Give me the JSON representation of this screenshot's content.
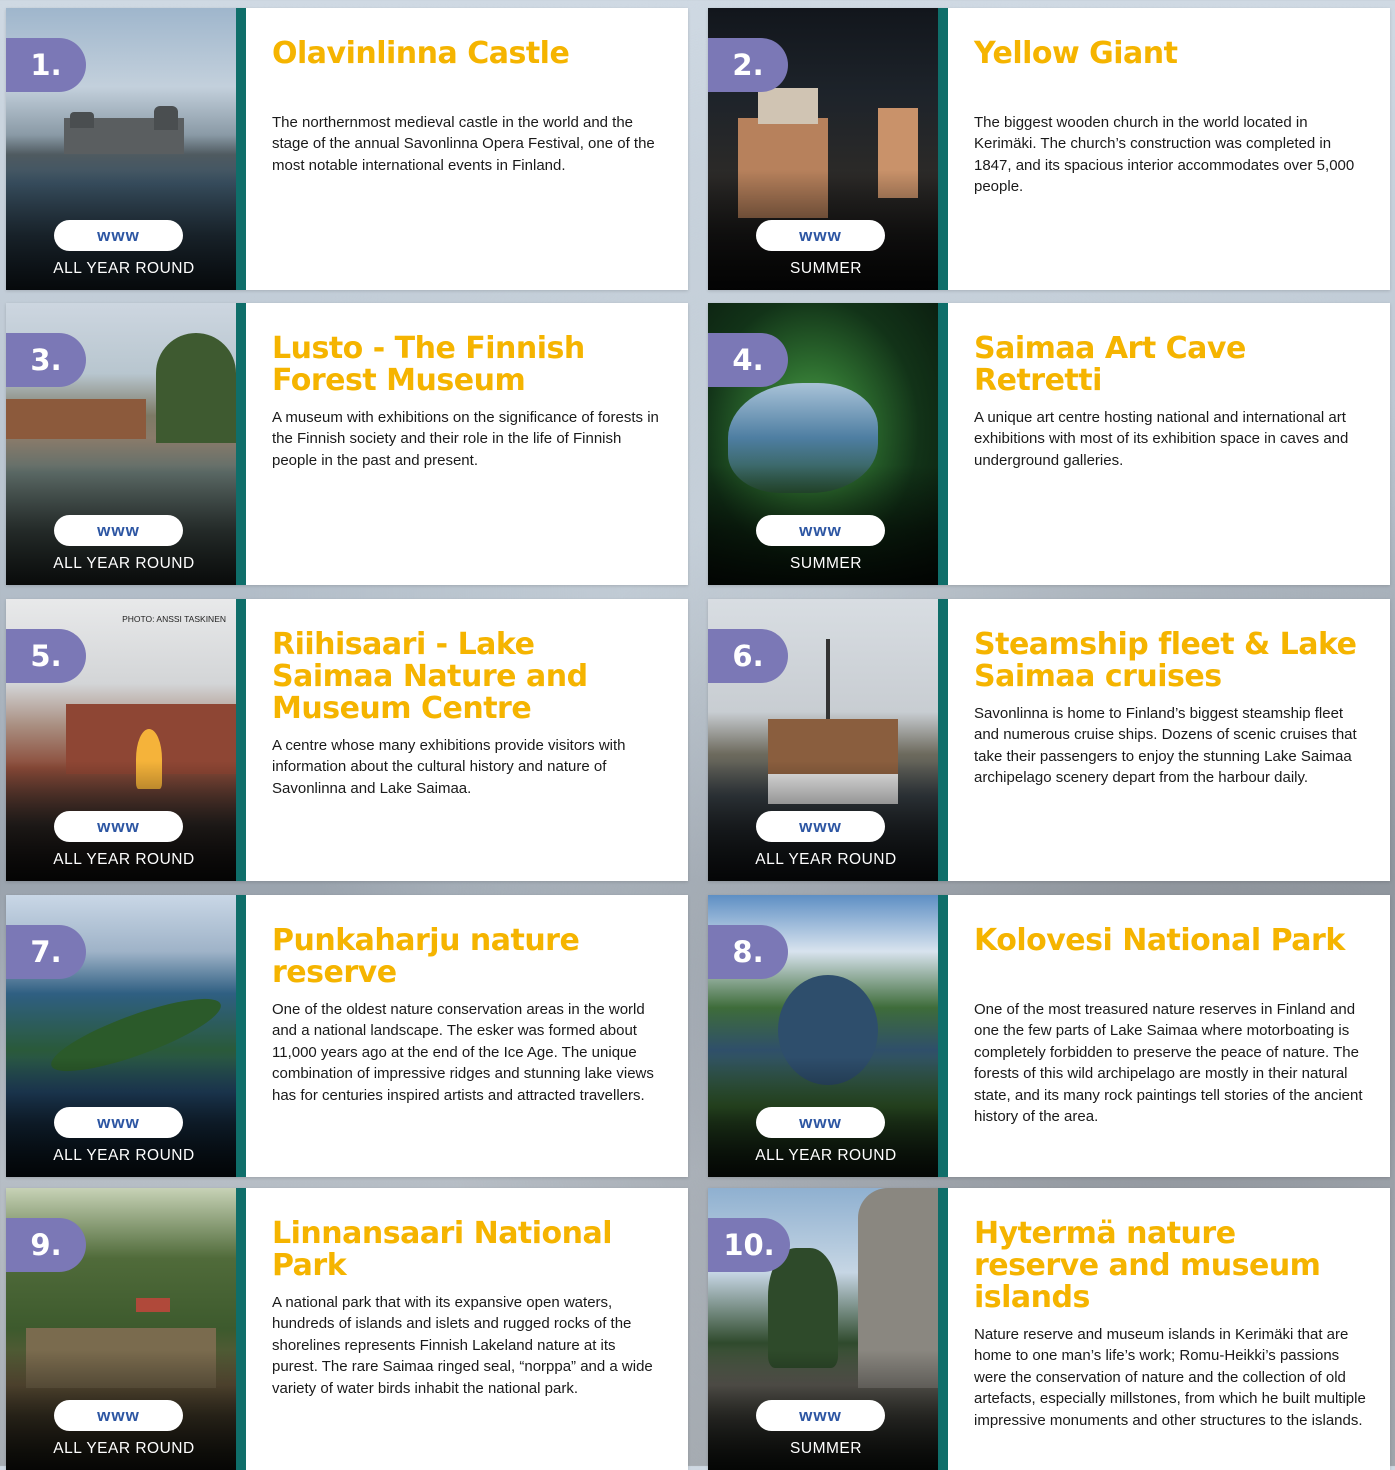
{
  "www_label": "www",
  "cards": [
    {
      "number": "1.",
      "title": "Olavinlinna Castle",
      "season": "ALL YEAR ROUND",
      "description": "The northernmost medieval castle in the world and the stage of the annual Savonlinna Opera Festival, one of the most notable international events in Finland."
    },
    {
      "number": "2.",
      "title": "Yellow Giant",
      "season": "SUMMER",
      "description": "The biggest wooden church in the world located in Kerimäki. The church’s construction was completed in 1847, and its spacious interior accommodates over 5,000 people."
    },
    {
      "number": "3.",
      "title": "Lusto - The Finnish Forest Museum",
      "season": "ALL YEAR ROUND",
      "description": "A museum with exhibitions on the significance of forests in the Finnish society and their role in the life of Finnish people in the past and present."
    },
    {
      "number": "4.",
      "title": "Saimaa Art Cave Retretti",
      "season": "SUMMER",
      "description": "A unique art centre hosting national and international art exhibitions with most of its exhibition space in caves and underground galleries."
    },
    {
      "number": "5.",
      "title": "Riihisaari - Lake Saimaa Nature and Museum Centre",
      "season": "ALL YEAR ROUND",
      "photo_credit": "PHOTO: ANSSI TASKINEN",
      "description": "A centre whose many exhibitions provide visitors with information about the cultural history and nature of Savonlinna and Lake Saimaa."
    },
    {
      "number": "6.",
      "title": "Steamship fleet & Lake Saimaa cruises",
      "season": "ALL YEAR ROUND",
      "description": "Savonlinna is home to Finland’s biggest steamship fleet and numerous cruise ships. Dozens of scenic cruises that take their passengers to enjoy the stunning Lake Saimaa archipelago scenery depart from the harbour daily."
    },
    {
      "number": "7.",
      "title": "Punkaharju nature reserve",
      "season": "ALL YEAR ROUND",
      "description": "One of the oldest nature conservation areas in the world and a national landscape. The esker was formed about 11,000 years ago at the end of the Ice Age. The unique combination of impressive ridges and stunning lake views has for centuries inspired artists and attracted travellers."
    },
    {
      "number": "8.",
      "title": "Kolovesi National Park",
      "season": "ALL YEAR ROUND",
      "description": "One of the most treasured nature reserves in Finland and one the few parts of Lake Saimaa where motorboating is completely forbidden to preserve the peace of nature. The forests of this wild archipelago are mostly in their natural state, and its many rock paintings tell stories of the ancient history of the area."
    },
    {
      "number": "9.",
      "title": "Linnansaari National Park",
      "season": "ALL YEAR ROUND",
      "description": "A national park that with its expansive open waters, hundreds of islands and islets and rugged rocks of the shorelines represents Finnish Lakeland nature at its purest. The rare Saimaa ringed seal, “norppa” and a wide variety of water birds inhabit the national park."
    },
    {
      "number": "10.",
      "title": "Hytermä nature reserve and museum islands",
      "season": "SUMMER",
      "description": "Nature reserve and museum islands in Kerimäki that are home to one man’s life’s work; Romu-Heikki’s passions were the conservation of nature and the collection of old artefacts, especially millstones, from which he built multiple impressive monuments and other structures to the islands."
    }
  ]
}
